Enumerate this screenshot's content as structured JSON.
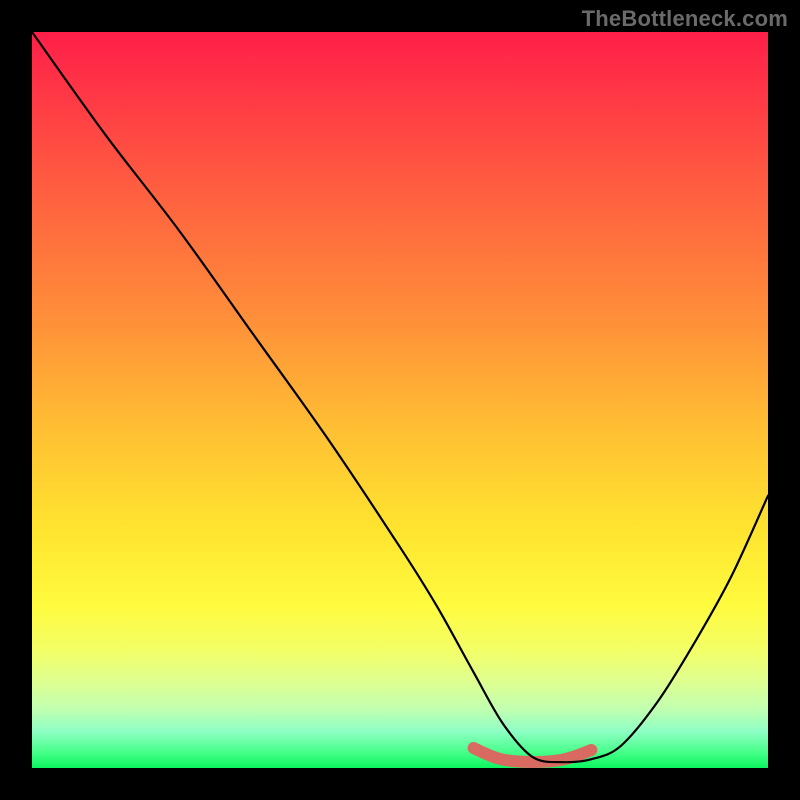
{
  "watermark": "TheBottleneck.com",
  "chart_data": {
    "type": "line",
    "title": "",
    "xlabel": "",
    "ylabel": "",
    "xlim": [
      0,
      100
    ],
    "ylim": [
      0,
      100
    ],
    "series": [
      {
        "name": "bottleneck-curve",
        "x": [
          0,
          10,
          20,
          30,
          40,
          50,
          55,
          60,
          64,
          68,
          72,
          76,
          80,
          85,
          90,
          95,
          100
        ],
        "y": [
          100,
          86,
          73,
          59,
          45,
          30,
          22,
          13,
          6,
          1.5,
          0.8,
          1.2,
          3,
          9,
          17,
          26,
          37
        ]
      }
    ],
    "highlight_range_x": [
      60,
      76
    ],
    "gradient_stops": [
      {
        "pos": 0,
        "color": "#ff1f49"
      },
      {
        "pos": 22,
        "color": "#ff6040"
      },
      {
        "pos": 55,
        "color": "#ffc233"
      },
      {
        "pos": 78,
        "color": "#fffb3f"
      },
      {
        "pos": 95,
        "color": "#8fffc5"
      },
      {
        "pos": 100,
        "color": "#0cf55f"
      }
    ]
  }
}
